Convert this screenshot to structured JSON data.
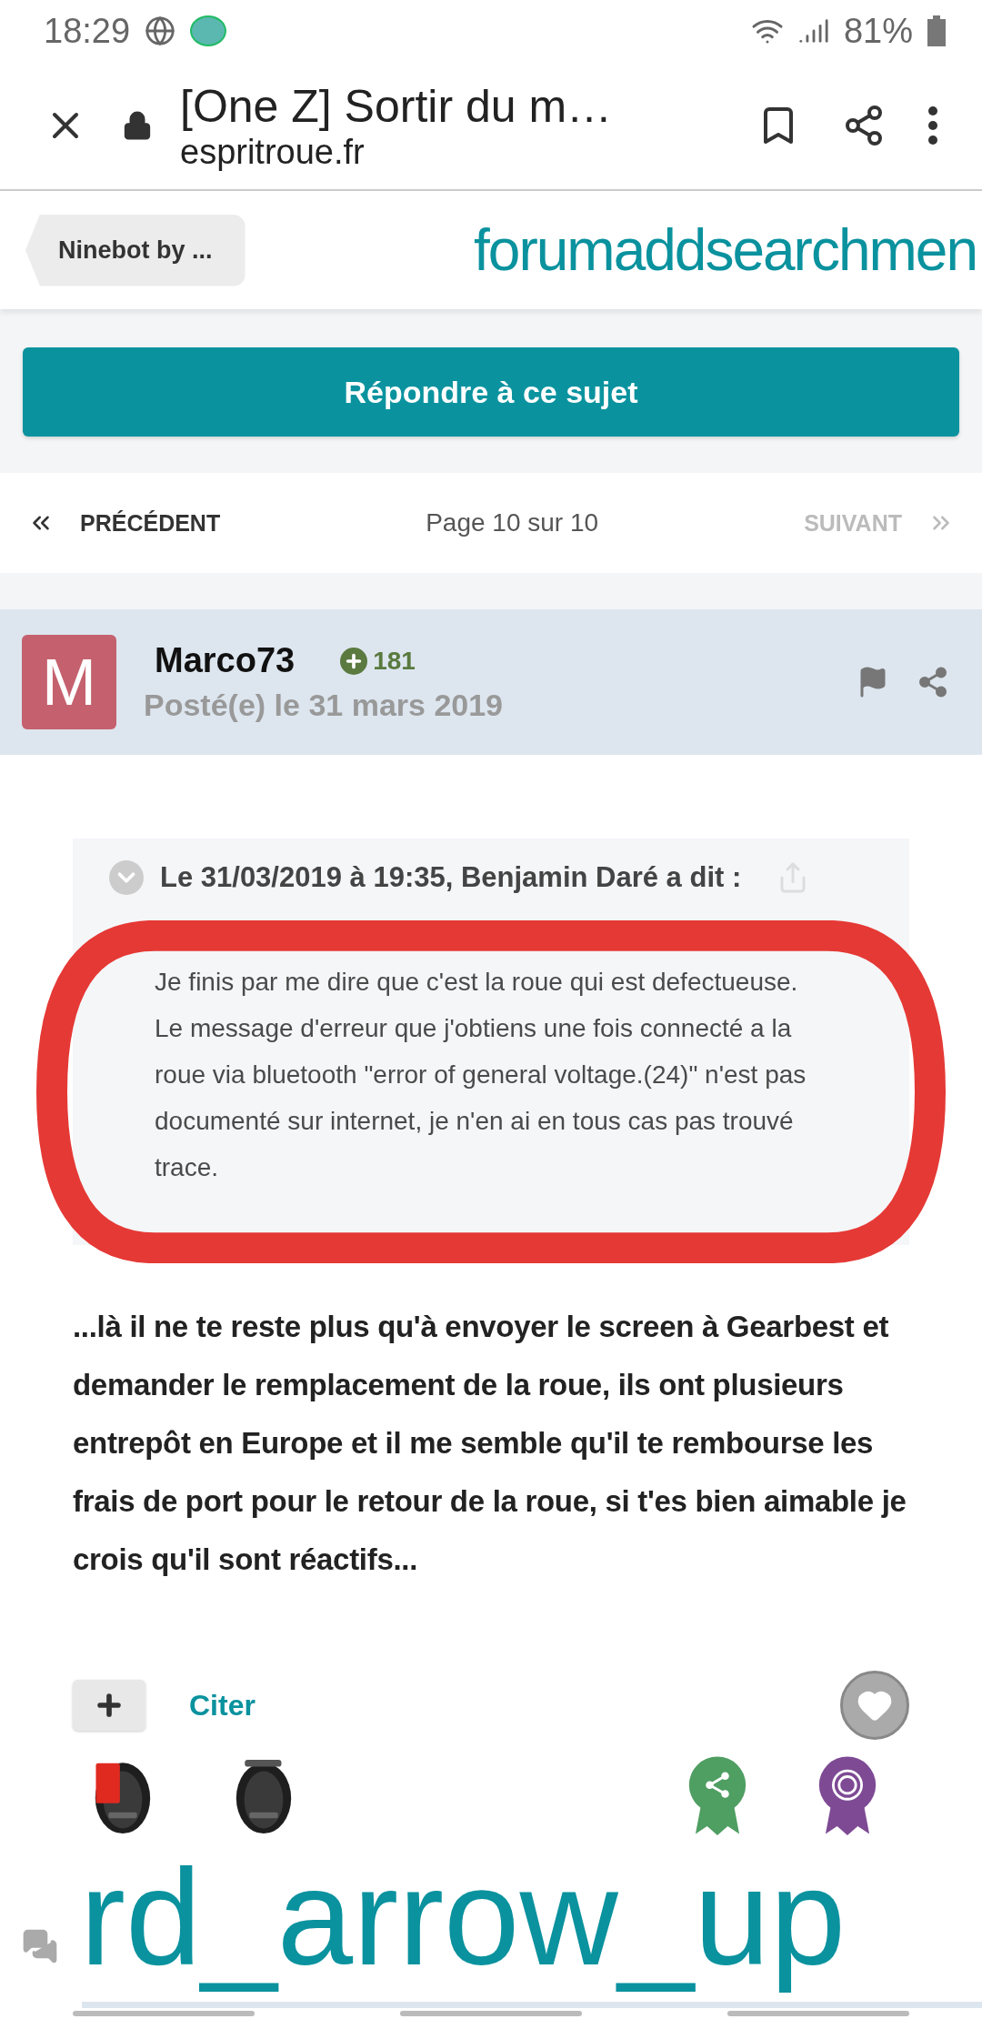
{
  "status_bar": {
    "time": "18:29",
    "battery": "81%"
  },
  "browser": {
    "title": "[One Z] Sortir du m…",
    "url": "espritroue.fr"
  },
  "header": {
    "breadcrumb": "Ninebot by ...",
    "icon_text": "forumaddsearchmen"
  },
  "reply_button": "Répondre à ce sujet",
  "pagination": {
    "previous": "PRÉCÉDENT",
    "page": "Page 10 sur 10",
    "next": "SUIVANT",
    "next_disabled": true
  },
  "post": {
    "avatar": "M",
    "author": "Marco73",
    "reputation": "181",
    "date": "Posté(e) le 31 mars 2019",
    "quote": {
      "header": "Le 31/03/2019 à 19:35, Benjamin Daré a dit :",
      "text": "Je finis par me dire que c'est la roue qui est defectueuse. Le message d'erreur que j'obtiens une fois connecté a la roue via bluetooth \"error of general voltage.(24)\" n'est pas documenté sur internet, je n'en ai en tous cas pas trouvé trace."
    },
    "body": "...là il ne te reste plus qu'à envoyer le screen à Gearbest et demander le remplacement de la roue, ils ont plusieurs entrepôt en Europe et il me semble qu'il te rembourse les frais de port pour le retour de la roue, si t'es bien aimable je crois qu'il sont réactifs...",
    "quote_button": "Citer"
  },
  "footer": {
    "icon_text": "rd_arrow_up"
  }
}
